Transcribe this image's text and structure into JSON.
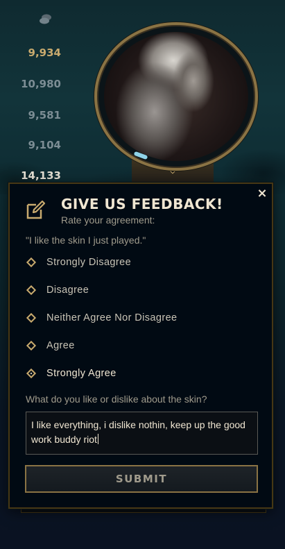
{
  "scores": [
    "9,934",
    "10,980",
    "9,581",
    "9,104",
    "14,133"
  ],
  "icons": {
    "coin": "coin-stack-icon",
    "edit": "edit-icon",
    "close": "close-icon"
  },
  "colors": {
    "gold": "#c8aa6e",
    "text_light": "#f0e6d2",
    "text_muted": "#a09b8c",
    "panel_bg": "#010a13"
  },
  "feedback": {
    "close_glyph": "×",
    "title": "GIVE US FEEDBACK!",
    "subtitle": "Rate your agreement:",
    "statement": "\"I like the skin I just played.\"",
    "options": [
      {
        "label": "Strongly Disagree",
        "selected": false
      },
      {
        "label": "Disagree",
        "selected": false
      },
      {
        "label": "Neither Agree Nor Disagree",
        "selected": false
      },
      {
        "label": "Agree",
        "selected": false
      },
      {
        "label": "Strongly Agree",
        "selected": true
      }
    ],
    "question": "What do you like or dislike about the skin?",
    "comment": "I like everything, i dislike nothin, keep up the good work buddy riot",
    "submit_label": "SUBMIT"
  }
}
